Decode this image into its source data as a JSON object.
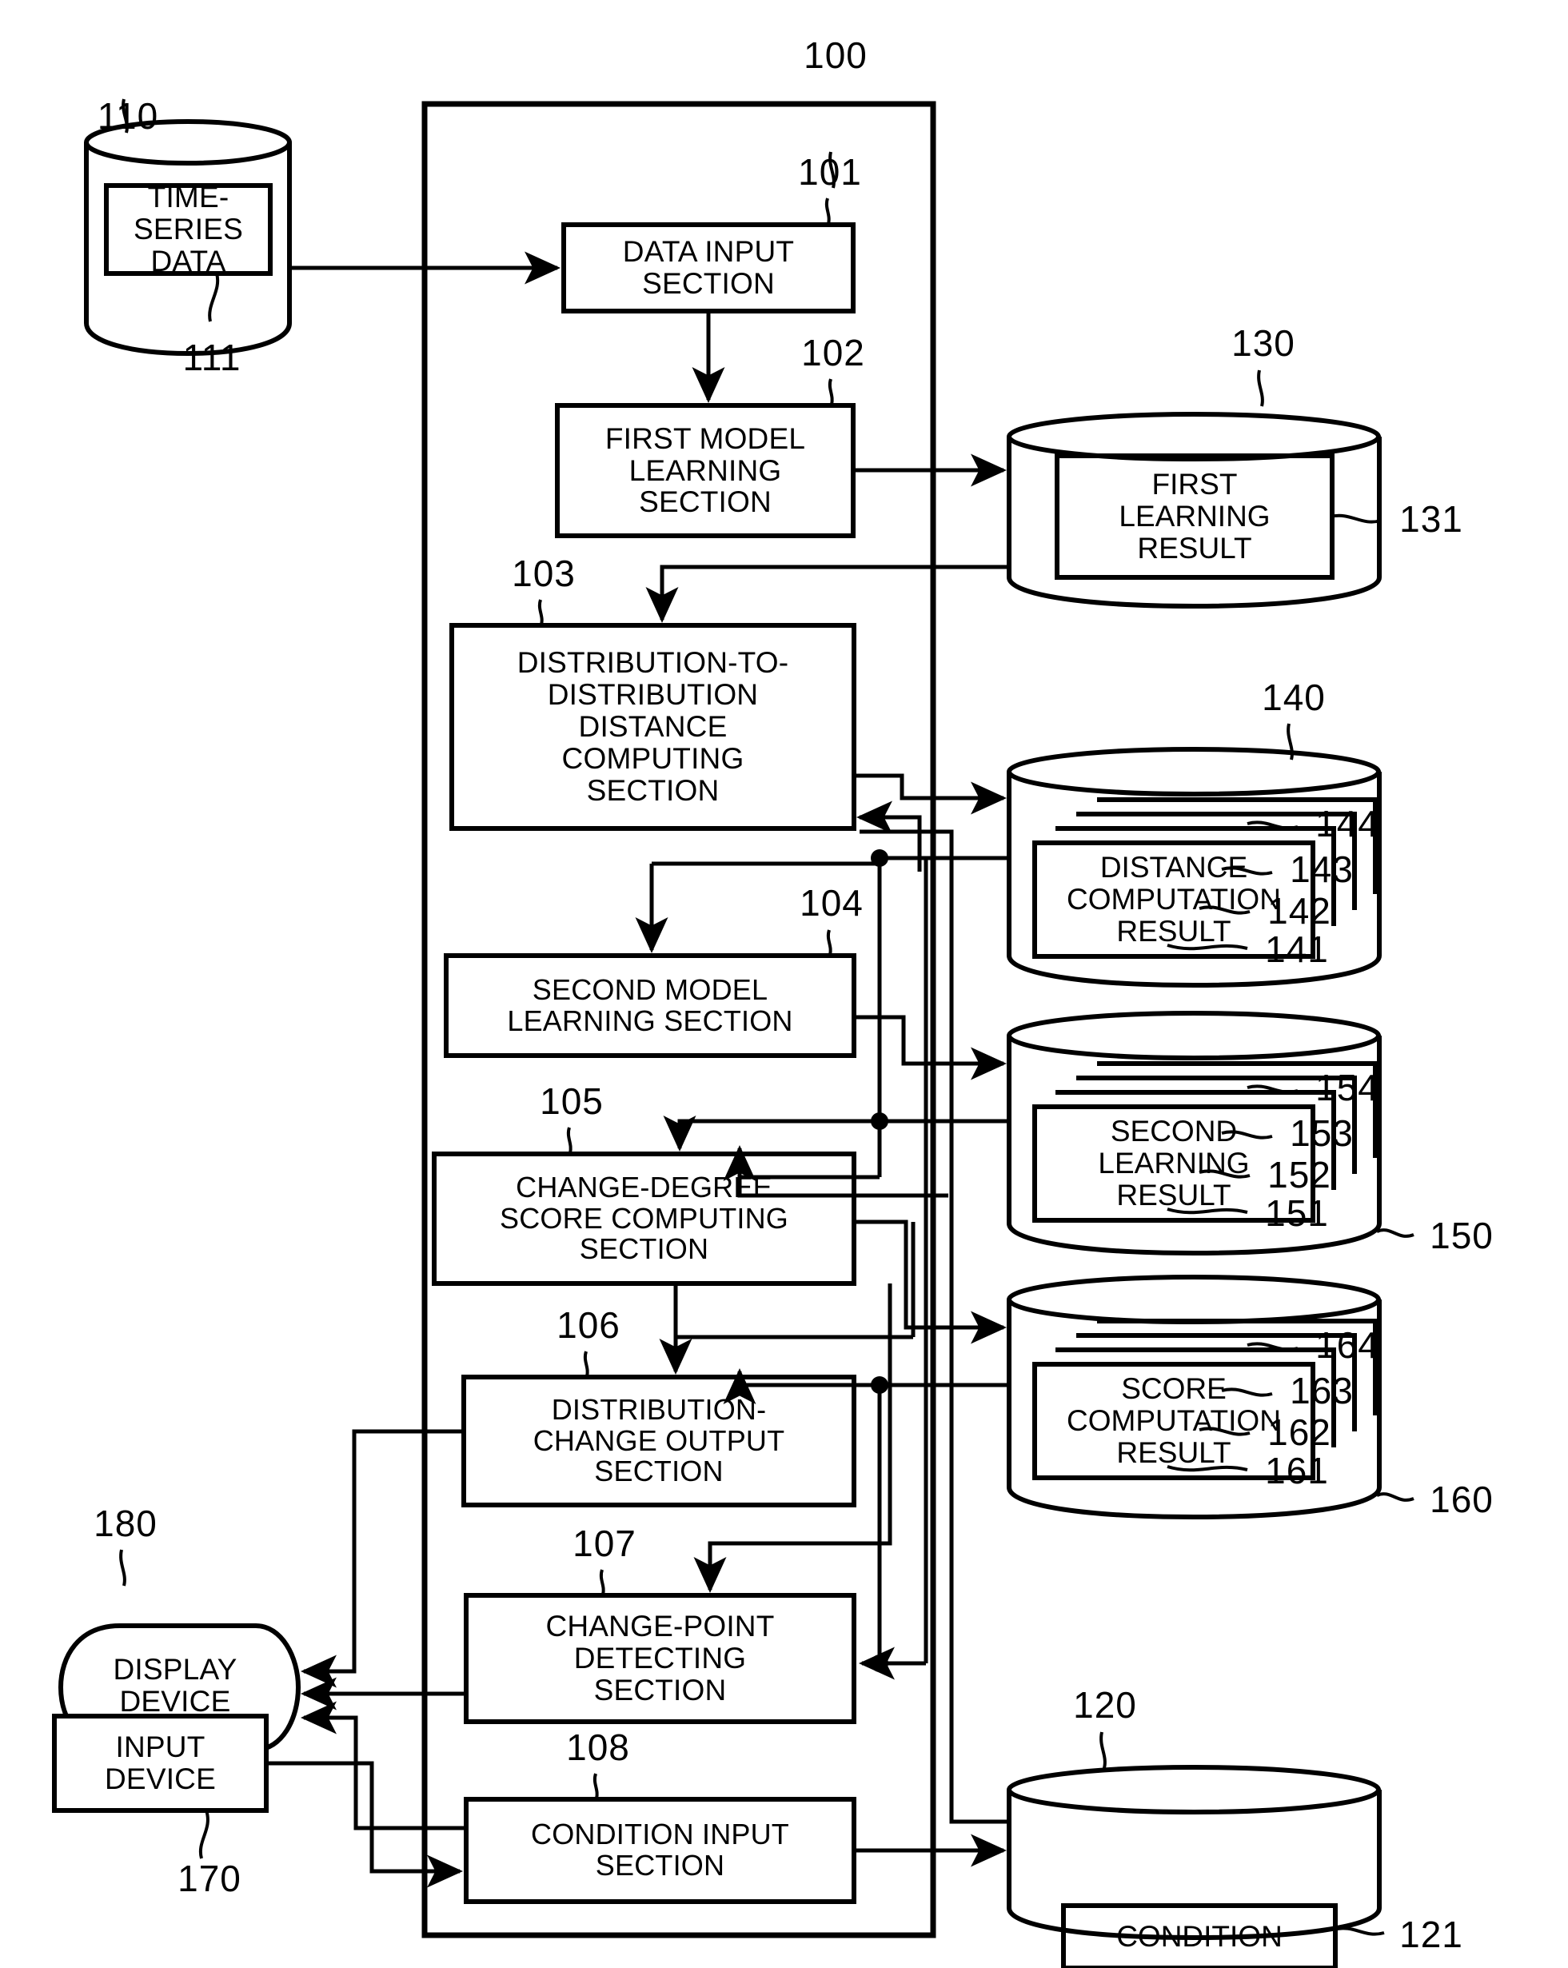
{
  "figure": {
    "type": "patent-block-diagram",
    "outer_system_ref": "100"
  },
  "sections": {
    "data_input": {
      "label": "DATA INPUT\nSECTION",
      "ref": "101"
    },
    "first_model_learning": {
      "label": "FIRST MODEL\nLEARNING\nSECTION",
      "ref": "102"
    },
    "distance_computing": {
      "label": "DISTRIBUTION-TO-\nDISTRIBUTION\nDISTANCE\nCOMPUTING\nSECTION",
      "ref": "103"
    },
    "second_model_learning": {
      "label": "SECOND MODEL\nLEARNING SECTION",
      "ref": "104"
    },
    "score_computing": {
      "label": "CHANGE-DEGREE\nSCORE COMPUTING\nSECTION",
      "ref": "105"
    },
    "distribution_change_output": {
      "label": "DISTRIBUTION-\nCHANGE OUTPUT\nSECTION",
      "ref": "106"
    },
    "change_point_detecting": {
      "label": "CHANGE-POINT\nDETECTING\nSECTION",
      "ref": "107"
    },
    "condition_input": {
      "label": "CONDITION INPUT\nSECTION",
      "ref": "108"
    }
  },
  "stores": {
    "time_series": {
      "label": "TIME-SERIES\nDATA",
      "cylinder_ref": "110",
      "content_ref": "111"
    },
    "first_learning_result": {
      "label": "FIRST\nLEARNING\nRESULT",
      "cylinder_ref": "130",
      "content_ref": "131"
    },
    "distance_computation_result": {
      "label": "DISTANCE\nCOMPUTATION\nRESULT",
      "cylinder_ref": "140",
      "layer_refs": [
        "144",
        "143",
        "142",
        "141"
      ]
    },
    "second_learning_result": {
      "label": "SECOND\nLEARNING\nRESULT",
      "cylinder_ref": "150",
      "layer_refs": [
        "154",
        "153",
        "152",
        "151"
      ]
    },
    "score_computation_result": {
      "label": "SCORE\nCOMPUTATION\nRESULT",
      "cylinder_ref": "160",
      "layer_refs": [
        "164",
        "163",
        "162",
        "161"
      ]
    },
    "condition": {
      "label": "CONDITION",
      "cylinder_ref": "120",
      "content_ref": "121"
    }
  },
  "devices": {
    "display": {
      "label": "DISPLAY\nDEVICE",
      "ref": "180"
    },
    "input": {
      "label": "INPUT\nDEVICE",
      "ref": "170"
    }
  },
  "colors": {
    "ink": "#000000",
    "paper": "#ffffff"
  }
}
